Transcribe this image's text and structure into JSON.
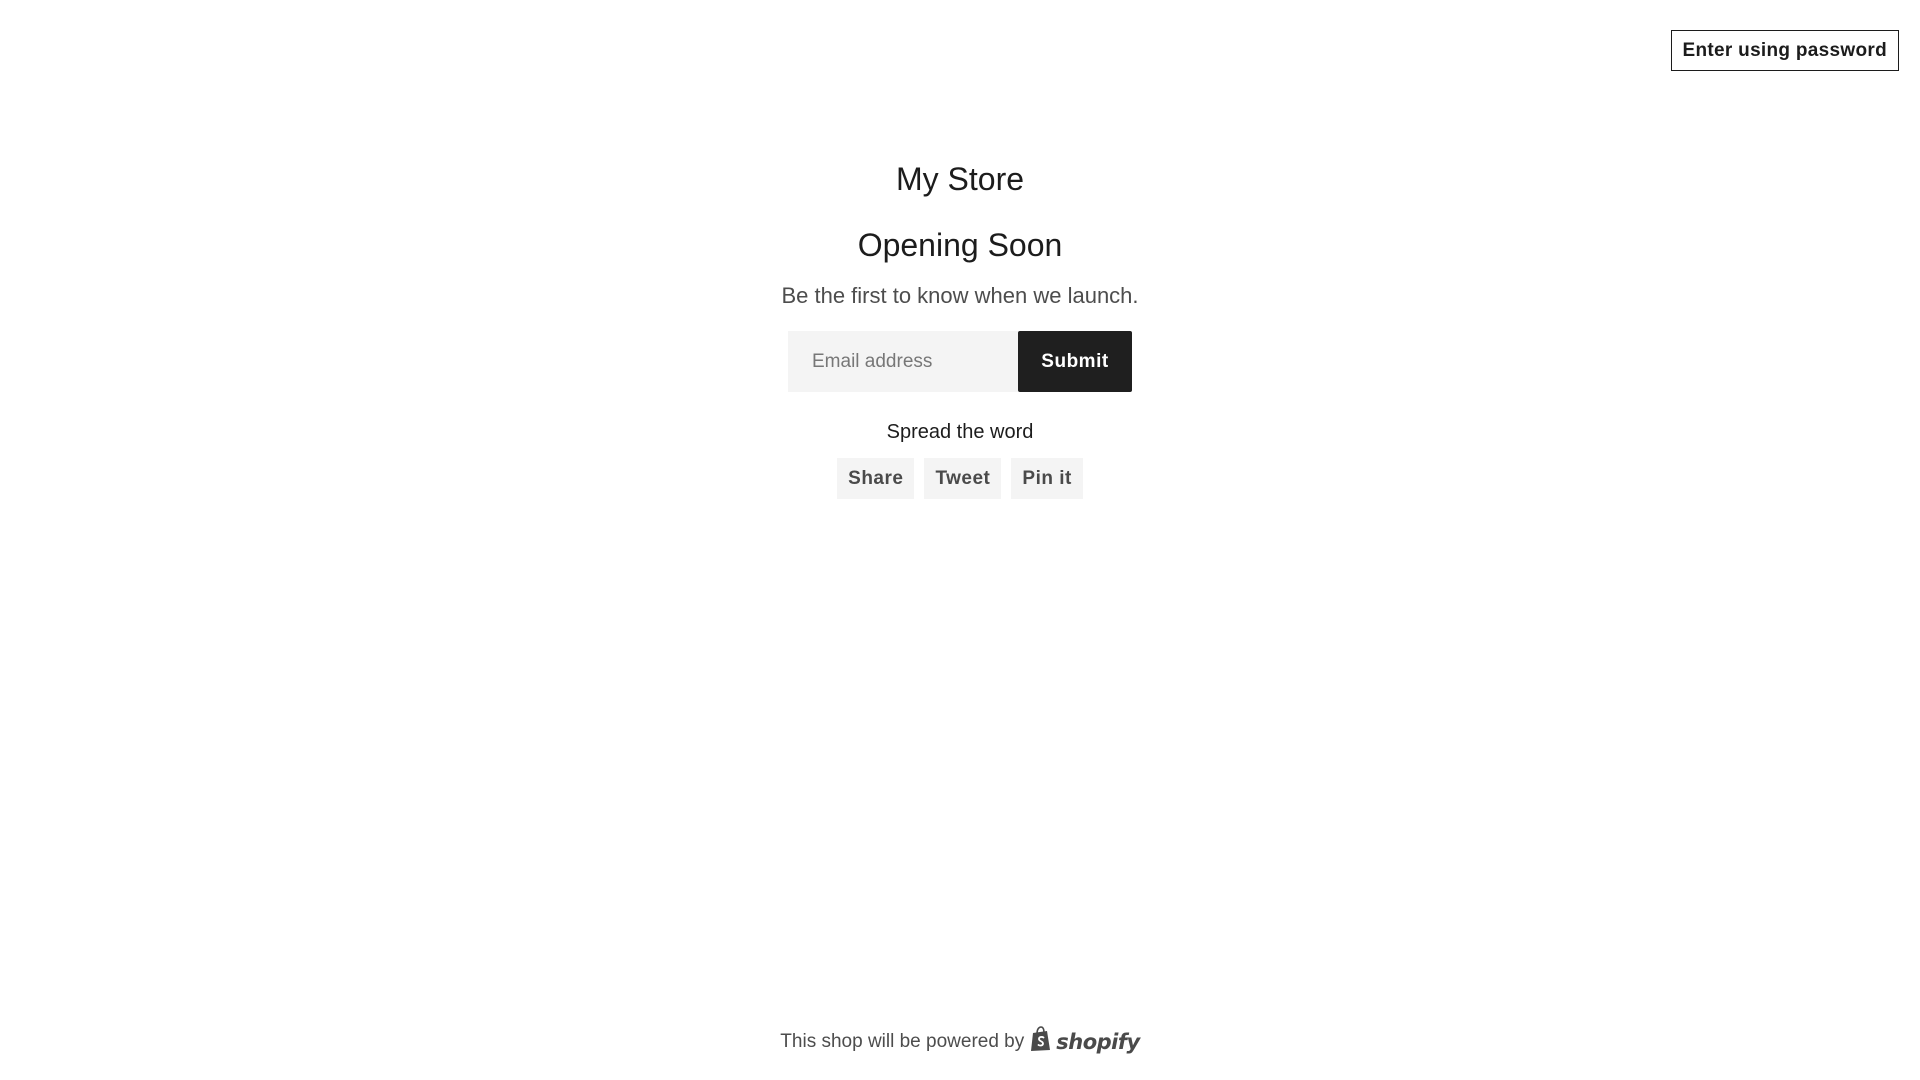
{
  "header": {
    "password_button_label": "Enter using password"
  },
  "main": {
    "store_name": "My Store",
    "headline": "Opening Soon",
    "subtext": "Be the first to know when we launch.",
    "signup": {
      "email_placeholder": "Email address",
      "submit_label": "Submit"
    },
    "spread_label": "Spread the word",
    "share_buttons": [
      {
        "label": "Share"
      },
      {
        "label": "Tweet"
      },
      {
        "label": "Pin it"
      }
    ]
  },
  "footer": {
    "powered_text": "This shop will be powered by",
    "brand_name": "shopify",
    "brand_icon": "shopify-bag-icon"
  },
  "colors": {
    "primary_text": "#1c1c1c",
    "secondary_text": "#4d4d4d",
    "button_dark": "#1f1f1f",
    "input_bg": "#f4f4f4"
  }
}
